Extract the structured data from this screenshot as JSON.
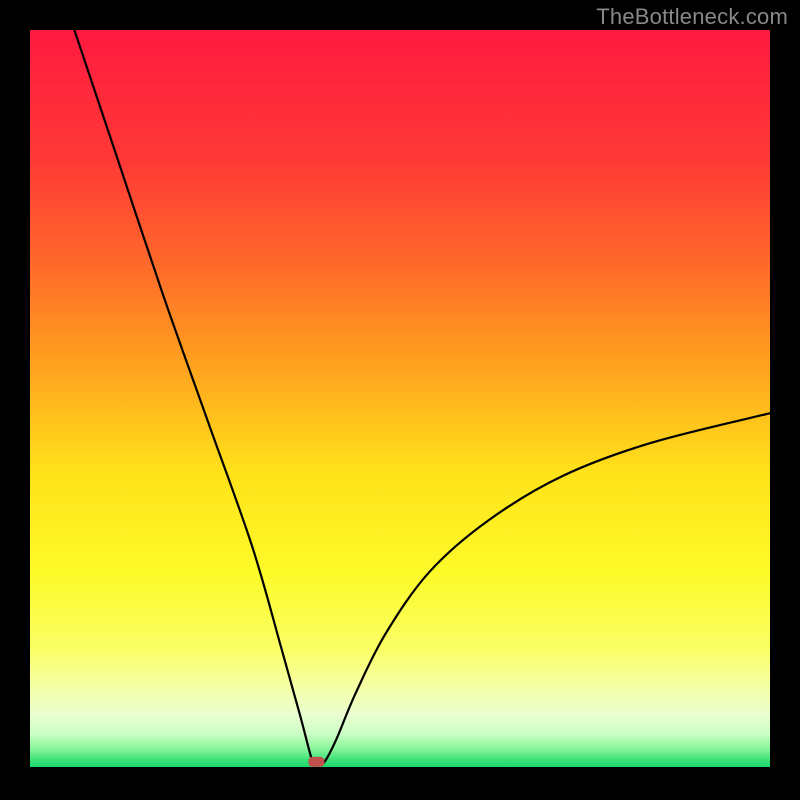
{
  "watermark": "TheBottleneck.com",
  "chart_data": {
    "type": "line",
    "title": "",
    "xlabel": "",
    "ylabel": "",
    "xlim": [
      0,
      100
    ],
    "ylim": [
      0,
      100
    ],
    "minimum_x_percent": 38.5,
    "marker": {
      "x_percent": 38.7,
      "y_percent": 0.7,
      "color": "#c0504d"
    },
    "background_gradient": {
      "stops": [
        {
          "pos": 0.0,
          "color": "#ff1a40"
        },
        {
          "pos": 0.18,
          "color": "#ff3a36"
        },
        {
          "pos": 0.32,
          "color": "#ff6a2a"
        },
        {
          "pos": 0.46,
          "color": "#ffa41e"
        },
        {
          "pos": 0.6,
          "color": "#ffe21a"
        },
        {
          "pos": 0.74,
          "color": "#fdfb2a"
        },
        {
          "pos": 0.84,
          "color": "#faff66"
        },
        {
          "pos": 0.9,
          "color": "#f4ffb0"
        },
        {
          "pos": 0.93,
          "color": "#e9ffd0"
        },
        {
          "pos": 0.955,
          "color": "#caffc4"
        },
        {
          "pos": 0.975,
          "color": "#8af59a"
        },
        {
          "pos": 0.99,
          "color": "#3ee27a"
        },
        {
          "pos": 1.0,
          "color": "#17d96a"
        }
      ]
    },
    "curve": {
      "description": "V-shaped bottleneck curve; left branch nearly linear from top-left to min; right branch rises with diminishing slope toward ~47% at right edge.",
      "left_branch": [
        {
          "x": 6.0,
          "y": 100.0
        },
        {
          "x": 12.0,
          "y": 82.0
        },
        {
          "x": 18.0,
          "y": 64.0
        },
        {
          "x": 24.0,
          "y": 47.0
        },
        {
          "x": 30.0,
          "y": 30.0
        },
        {
          "x": 34.0,
          "y": 16.0
        },
        {
          "x": 36.5,
          "y": 7.0
        },
        {
          "x": 38.0,
          "y": 1.3
        },
        {
          "x": 38.5,
          "y": 0.4
        }
      ],
      "right_branch": [
        {
          "x": 38.5,
          "y": 0.4
        },
        {
          "x": 39.2,
          "y": 0.3
        },
        {
          "x": 40.0,
          "y": 1.0
        },
        {
          "x": 41.5,
          "y": 4.0
        },
        {
          "x": 44.0,
          "y": 10.0
        },
        {
          "x": 48.0,
          "y": 18.0
        },
        {
          "x": 54.0,
          "y": 26.5
        },
        {
          "x": 62.0,
          "y": 33.5
        },
        {
          "x": 72.0,
          "y": 39.5
        },
        {
          "x": 84.0,
          "y": 44.0
        },
        {
          "x": 100.0,
          "y": 48.0
        }
      ]
    }
  }
}
